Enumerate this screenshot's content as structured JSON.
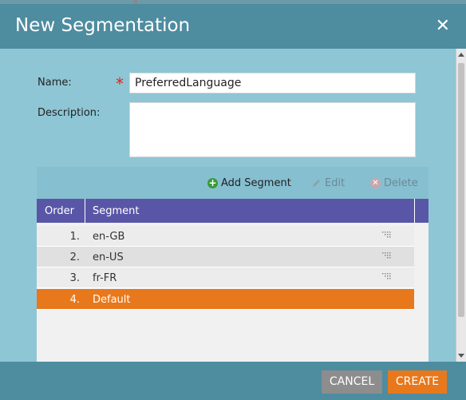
{
  "dialog": {
    "title": "New Segmentation",
    "close_icon": "close-icon"
  },
  "form": {
    "name_label": "Name:",
    "required_mark": "*",
    "name_value": "PreferredLanguage",
    "description_label": "Description:",
    "description_value": ""
  },
  "toolbar": {
    "add_label": "Add Segment",
    "edit_label": "Edit",
    "delete_label": "Delete"
  },
  "grid": {
    "columns": [
      "Order",
      "Segment"
    ],
    "rows": [
      {
        "order": "1.",
        "segment": "en-GB"
      },
      {
        "order": "2.",
        "segment": "en-US"
      },
      {
        "order": "3.",
        "segment": "fr-FR"
      },
      {
        "order": "4.",
        "segment": "Default"
      }
    ],
    "selected_row": 3
  },
  "footer": {
    "cancel_label": "CANCEL",
    "create_label": "CREATE"
  },
  "colors": {
    "header": "#4e8ca0",
    "body": "#8ec6d5",
    "grid_header": "#5a56a7",
    "accent": "#e8781c",
    "cancel": "#8d8d8d"
  }
}
